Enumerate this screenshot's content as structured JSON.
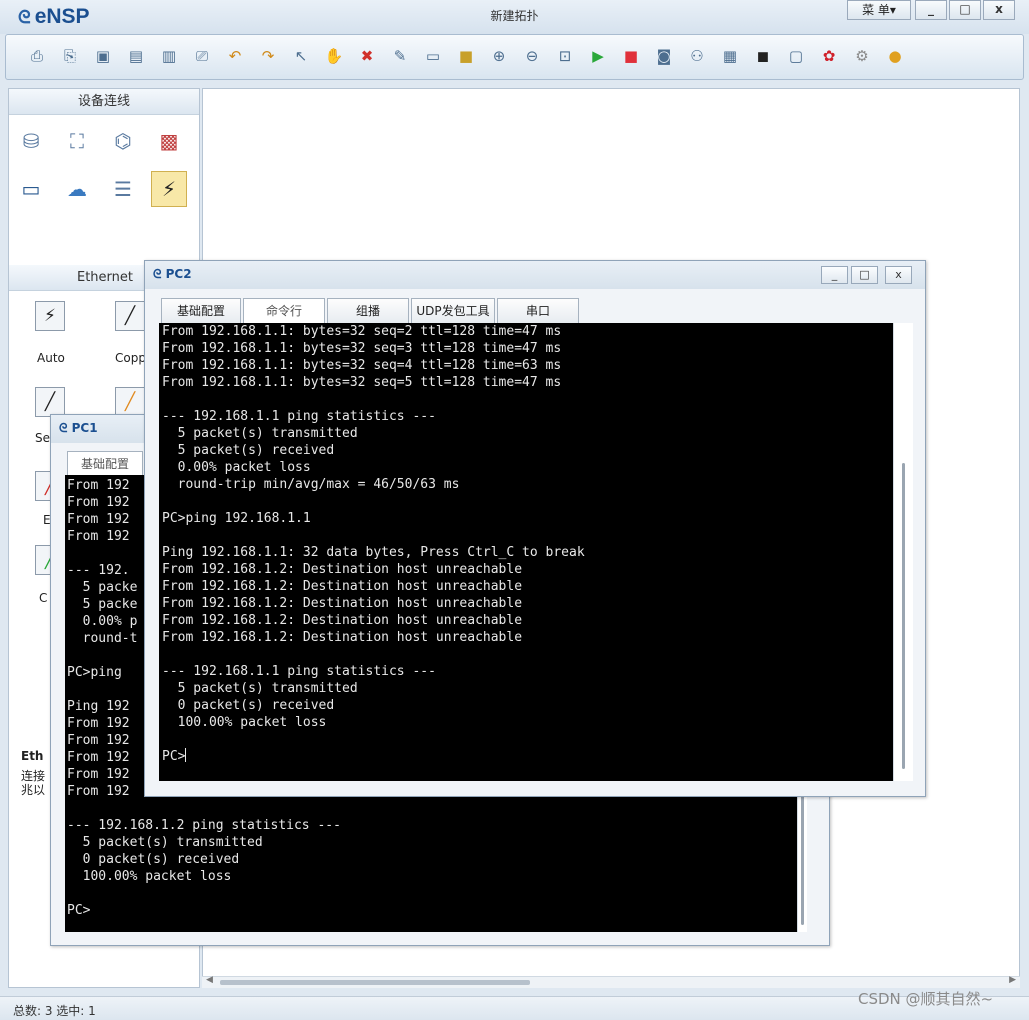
{
  "app": {
    "title": "eNSP",
    "doc_title": "新建拓扑",
    "menu_label": "菜 单▾",
    "minimize": "_",
    "maximize": "□",
    "close": "x"
  },
  "toolbar": {
    "icons": [
      "new-topology-icon",
      "new-example-icon",
      "open-icon",
      "save-icon",
      "save-as-icon",
      "print-icon",
      "undo-icon",
      "redo-icon",
      "select-icon",
      "pan-icon",
      "delete-icon",
      "delete-link-icon",
      "text-icon",
      "rectangle-icon",
      "zoom-in-icon",
      "zoom-out-icon",
      "fit-icon",
      "start-icon",
      "stop-icon",
      "capture-icon",
      "topology-icon",
      "grid-icon",
      "console-icon",
      "chat-icon",
      "huawei-icon",
      "settings-icon",
      "help-icon"
    ]
  },
  "left_panel": {
    "header": "设备连线",
    "section_title": "Ethernet",
    "cables": [
      {
        "label": "Auto"
      },
      {
        "label": "Copp"
      },
      {
        "label": "Se"
      },
      {
        "label": "E"
      },
      {
        "label": "C"
      }
    ],
    "footer_title": "Eth",
    "footer_desc": "连接\n兆以"
  },
  "status": {
    "text": "总数: 3 选中: 1"
  },
  "watermark": "CSDN @顺其自然~",
  "pc1": {
    "title": "PC1",
    "tabs": [
      "基础配置"
    ],
    "lines": [
      "From 192",
      "From 192",
      "From 192",
      "From 192",
      "",
      "--- 192.",
      "  5 packe",
      "  5 packe",
      "  0.00% p",
      "  round-t",
      "",
      "PC>ping ",
      "",
      "Ping 192",
      "From 192",
      "From 192",
      "From 192",
      "From 192",
      "From 192",
      "",
      "--- 192.168.1.2 ping statistics ---",
      "  5 packet(s) transmitted",
      "  0 packet(s) received",
      "  100.00% packet loss",
      "",
      "PC>"
    ]
  },
  "pc2": {
    "title": "PC2",
    "tabs": [
      "基础配置",
      "命令行",
      "组播",
      "UDP发包工具",
      "串口"
    ],
    "lines": [
      "From 192.168.1.1: bytes=32 seq=2 ttl=128 time=47 ms",
      "From 192.168.1.1: bytes=32 seq=3 ttl=128 time=47 ms",
      "From 192.168.1.1: bytes=32 seq=4 ttl=128 time=63 ms",
      "From 192.168.1.1: bytes=32 seq=5 ttl=128 time=47 ms",
      "",
      "--- 192.168.1.1 ping statistics ---",
      "  5 packet(s) transmitted",
      "  5 packet(s) received",
      "  0.00% packet loss",
      "  round-trip min/avg/max = 46/50/63 ms",
      "",
      "PC>ping 192.168.1.1",
      "",
      "Ping 192.168.1.1: 32 data bytes, Press Ctrl_C to break",
      "From 192.168.1.2: Destination host unreachable",
      "From 192.168.1.2: Destination host unreachable",
      "From 192.168.1.2: Destination host unreachable",
      "From 192.168.1.2: Destination host unreachable",
      "From 192.168.1.2: Destination host unreachable",
      "",
      "--- 192.168.1.1 ping statistics ---",
      "  5 packet(s) transmitted",
      "  0 packet(s) received",
      "  100.00% packet loss",
      "",
      "PC>"
    ]
  }
}
